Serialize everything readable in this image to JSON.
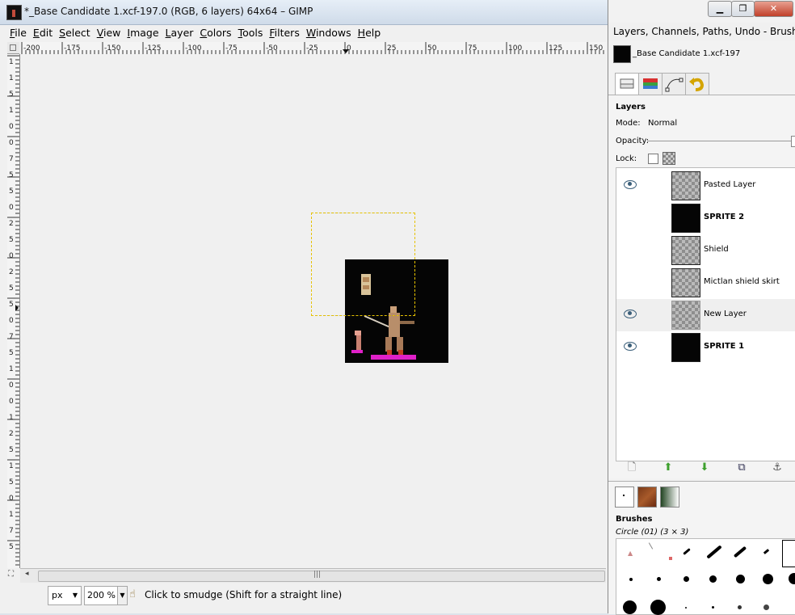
{
  "window": {
    "title": "*_Base Candidate 1.xcf-197.0 (RGB, 6 layers) 64x64 – GIMP"
  },
  "menu": [
    "File",
    "Edit",
    "Select",
    "View",
    "Image",
    "Layer",
    "Colors",
    "Tools",
    "Filters",
    "Windows",
    "Help"
  ],
  "hruler_labels": [
    "-200",
    "-175",
    "-150",
    "-125",
    "-100",
    "-75",
    "-50",
    "-25",
    "0",
    "25",
    "50",
    "75",
    "100",
    "125",
    "150"
  ],
  "vruler_labels": [
    "1",
    "1",
    "5",
    "1",
    "0",
    "0",
    "7",
    "5",
    "5",
    "0",
    "2",
    "5",
    "0",
    "2",
    "5",
    "5",
    "0",
    "7",
    "5",
    "1",
    "0",
    "0",
    "1",
    "2",
    "5",
    "1",
    "5",
    "0",
    "1",
    "7",
    "5"
  ],
  "status": {
    "unit": "px",
    "zoom": "200 %",
    "message": "Click to smudge (Shift for a straight line)"
  },
  "dock": {
    "title": "Layers, Channels, Paths, Undo - Brushes, Pa",
    "image_name": "_Base Candidate 1.xcf-197",
    "layers_heading": "Layers",
    "mode_label": "Mode:",
    "mode_value": "Normal",
    "opacity_label": "Opacity:",
    "lock_label": "Lock:",
    "layers": [
      {
        "name": "Pasted Layer",
        "bold": false,
        "visible": true
      },
      {
        "name": "SPRITE 2",
        "bold": true,
        "visible": false
      },
      {
        "name": "Shield",
        "bold": false,
        "visible": false
      },
      {
        "name": "Mictlan shield skirt",
        "bold": false,
        "visible": false
      },
      {
        "name": "New Layer",
        "bold": false,
        "visible": true
      },
      {
        "name": "SPRITE 1",
        "bold": true,
        "visible": true
      }
    ],
    "brushes_heading": "Brushes",
    "brush_name": "Circle (01) (3 × 3)"
  },
  "icons": {
    "new_layer": "new-layer-icon",
    "raise": "raise-layer-icon",
    "lower": "lower-layer-icon",
    "duplicate": "duplicate-layer-icon",
    "anchor": "anchor-layer-icon"
  }
}
